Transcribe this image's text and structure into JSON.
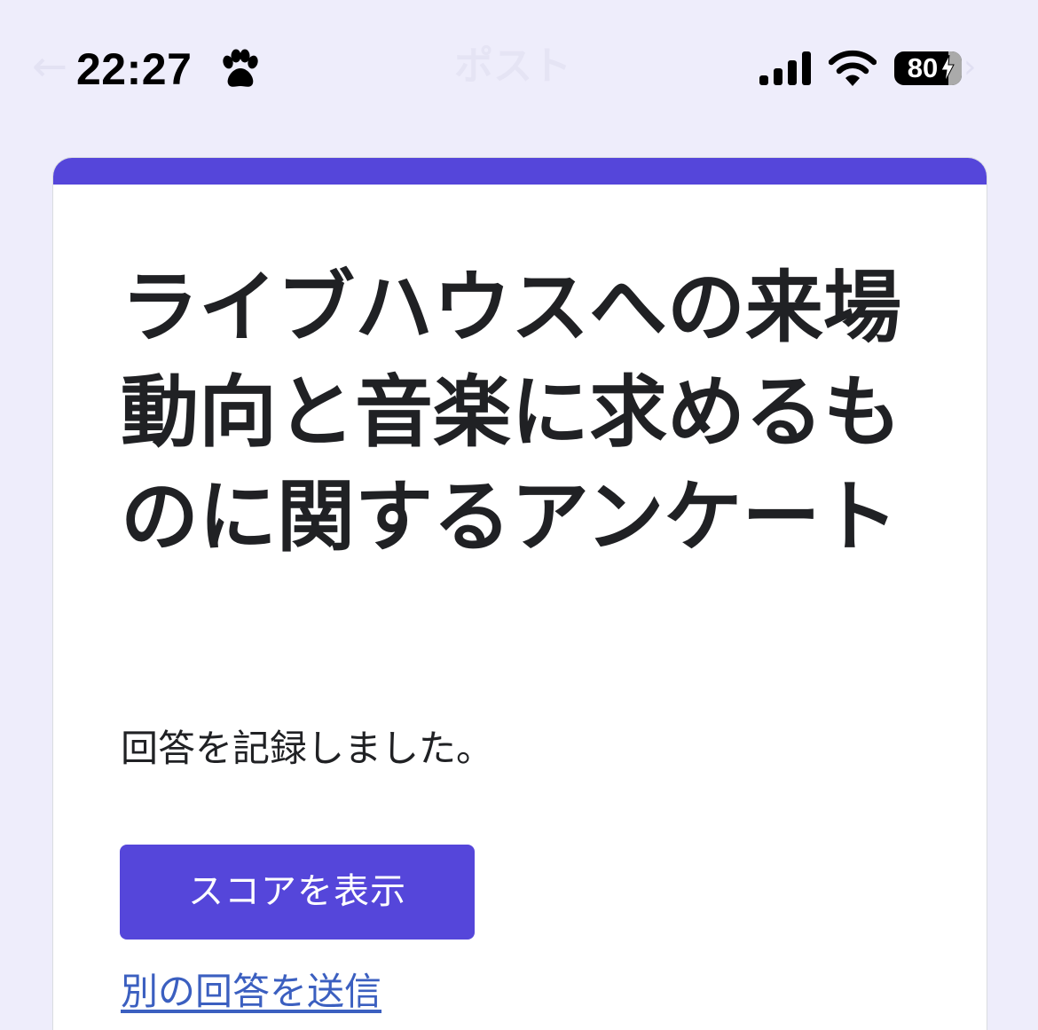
{
  "status_bar": {
    "time": "22:27",
    "battery_percent": "80",
    "battery_level": 0.8,
    "ghost_title": "ポスト",
    "ghost_back": "←",
    "ghost_chevron": "›"
  },
  "icons": {
    "paw": "paw-icon",
    "signal": "cellular-signal-icon",
    "wifi": "wifi-icon",
    "battery": "battery-icon",
    "charging": "charging-bolt-icon"
  },
  "colors": {
    "accent": "#5546da",
    "background": "#eeedfb",
    "link": "#3b5fc0",
    "card": "#ffffff"
  },
  "form": {
    "title": "ライブハウスへの来場動向と音楽に求めるものに関するアンケート",
    "confirmation": "回答を記録しました。",
    "score_button_label": "スコアを表示",
    "another_response_link": "別の回答を送信"
  }
}
